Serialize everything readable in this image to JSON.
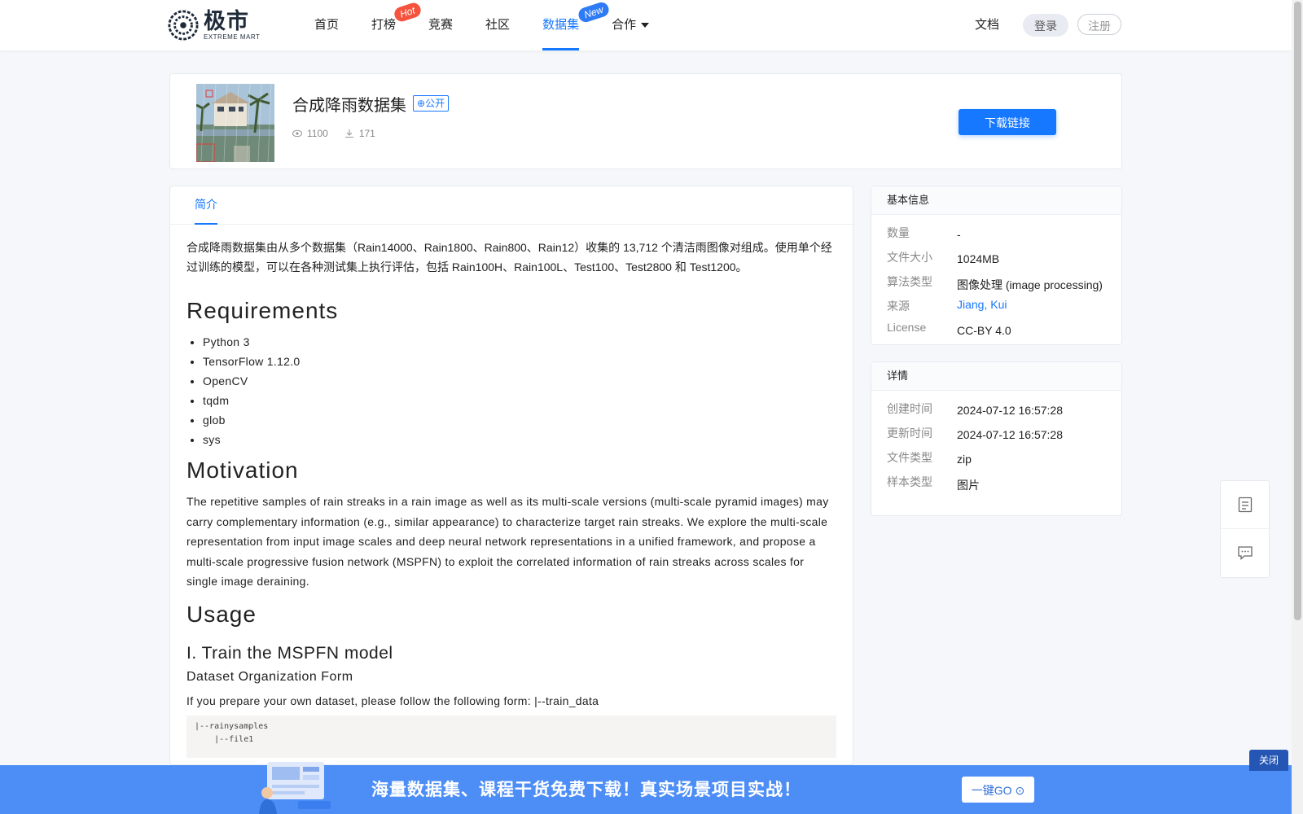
{
  "brand": {
    "name_cn": "极市",
    "name_en": "EXTREME MART"
  },
  "nav": {
    "items": [
      {
        "label": "首页"
      },
      {
        "label": "打榜",
        "badge": "Hot"
      },
      {
        "label": "竞赛"
      },
      {
        "label": "社区"
      },
      {
        "label": "数据集",
        "badge": "New",
        "active": true
      },
      {
        "label": "合作"
      }
    ],
    "docs": "文档",
    "login": "登录",
    "register": "注册"
  },
  "dataset": {
    "title": "合成降雨数据集",
    "visibility": "公开",
    "views": "1100",
    "downloads": "171",
    "download_label": "下载链接"
  },
  "tabs": {
    "intro": "简介"
  },
  "content": {
    "intro": "合成降雨数据集由从多个数据集（Rain14000、Rain1800、Rain800、Rain12）收集的 13,712 个清洁雨图像对组成。使用单个经过训练的模型，可以在各种测试集上执行评估，包括 Rain100H、Rain100L、Test100、Test2800 和 Test1200。",
    "requirements_heading": "Requirements",
    "requirements": [
      "Python 3",
      "TensorFlow 1.12.0",
      "OpenCV",
      "tqdm",
      "glob",
      "sys"
    ],
    "motivation_heading": "Motivation",
    "motivation": "The repetitive samples of rain streaks in a rain image as well as its multi-scale versions (multi-scale pyramid images) may carry complementary information (e.g., similar appearance) to characterize target rain streaks. We explore the multi-scale representation from input image scales and deep neural network representations in a unified framework, and propose a multi-scale progressive fusion network (MSPFN) to exploit the correlated information of rain streaks across scales for single image deraining.",
    "usage_heading": "Usage",
    "train_heading": "I. Train the MSPFN model",
    "dataset_org_heading": "Dataset Organization Form",
    "dataset_org_text": "If you prepare your own dataset, please follow the following form: |--train_data",
    "code_lines": "|--rainysamples\n    |--file1"
  },
  "basic_info": {
    "heading": "基本信息",
    "rows": [
      {
        "key": "数量",
        "value": "-"
      },
      {
        "key": "文件大小",
        "value": "1024MB"
      },
      {
        "key": "算法类型",
        "value": "图像处理 (image processing)"
      },
      {
        "key": "来源",
        "value": "Jiang, Kui"
      },
      {
        "key": "License",
        "value": "CC-BY 4.0"
      }
    ]
  },
  "details": {
    "heading": "详情",
    "rows": [
      {
        "key": "创建时间",
        "value": "2024-07-12 16:57:28"
      },
      {
        "key": "更新时间",
        "value": "2024-07-12 16:57:28"
      },
      {
        "key": "文件类型",
        "value": "zip"
      },
      {
        "key": "样本类型",
        "value": "图片"
      }
    ]
  },
  "floating_tools": {
    "icons": [
      "document-icon",
      "comment-icon"
    ]
  },
  "banner": {
    "text": "海量数据集、课程干货免费下载！真实场景项目实战！",
    "go_label": "一键GO",
    "close_label": "关闭"
  },
  "colors": {
    "accent": "#1677ff",
    "banner": "#4d8ef6",
    "hot": "#f5533d"
  }
}
